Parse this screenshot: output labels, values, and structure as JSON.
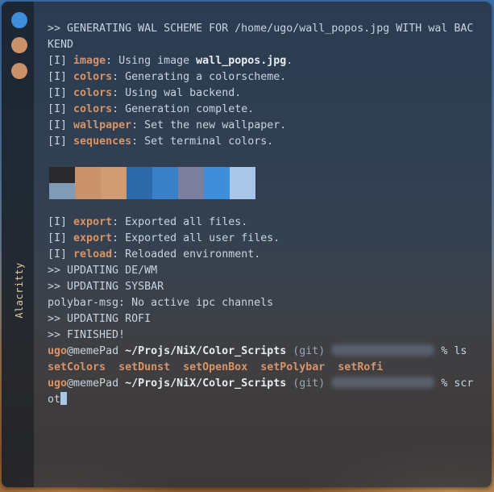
{
  "window": {
    "label": "Alacritty"
  },
  "palette": {
    "top": [
      "#2a2a2e",
      "#c9926a",
      "#d19b73",
      "#2f6aa8",
      "#3a80c8",
      "#7b7e9c",
      "#3e8edb",
      "#a7c6e8"
    ],
    "bottom": [
      "#7f9bb5",
      "#c9926a",
      "#d19b73",
      "#2f6aa8",
      "#3a80c8",
      "#7b7e9c",
      "#3e8edb",
      "#a7c6e8"
    ]
  },
  "output": {
    "header_1": ">> GENERATING WAL SCHEME FOR /home/ugo/wall_popos.jpg WITH wal BAC",
    "header_2": "KEND",
    "info_prefix": "[I]",
    "lines1": [
      {
        "kw": "image",
        "msg": "Using image ",
        "extra": "wall_popos.jpg",
        "tail": "."
      },
      {
        "kw": "colors",
        "msg": "Generating a colorscheme.",
        "extra": "",
        "tail": ""
      },
      {
        "kw": "colors",
        "msg": "Using wal backend.",
        "extra": "",
        "tail": ""
      },
      {
        "kw": "colors",
        "msg": "Generation complete.",
        "extra": "",
        "tail": ""
      },
      {
        "kw": "wallpaper",
        "msg": "Set the new wallpaper.",
        "extra": "",
        "tail": ""
      },
      {
        "kw": "sequences",
        "msg": "Set terminal colors.",
        "extra": "",
        "tail": ""
      }
    ],
    "lines2": [
      {
        "kw": "export",
        "msg": "Exported all files."
      },
      {
        "kw": "export",
        "msg": "Exported all user files."
      },
      {
        "kw": "reload",
        "msg": "Reloaded environment."
      }
    ],
    "updating_dewm": ">> UPDATING DE/WM",
    "updating_sysbar": ">> UPDATING SYSBAR",
    "polybar_msg": "polybar-msg: No active ipc channels",
    "updating_rofi": ">> UPDATING ROFI",
    "finished": ">> FINISHED!"
  },
  "prompt": {
    "user": "ugo",
    "host": "@memePad",
    "path": "~/Projs/NiX/Color_Scripts",
    "git": "(git)",
    "symbol": "%",
    "cmd1": "ls",
    "cmd2_part1": "scr",
    "cmd2_part2": "ot"
  },
  "ls_files": [
    "setColors",
    "setDunst",
    "setOpenBox",
    "setPolybar",
    "setRofi"
  ]
}
